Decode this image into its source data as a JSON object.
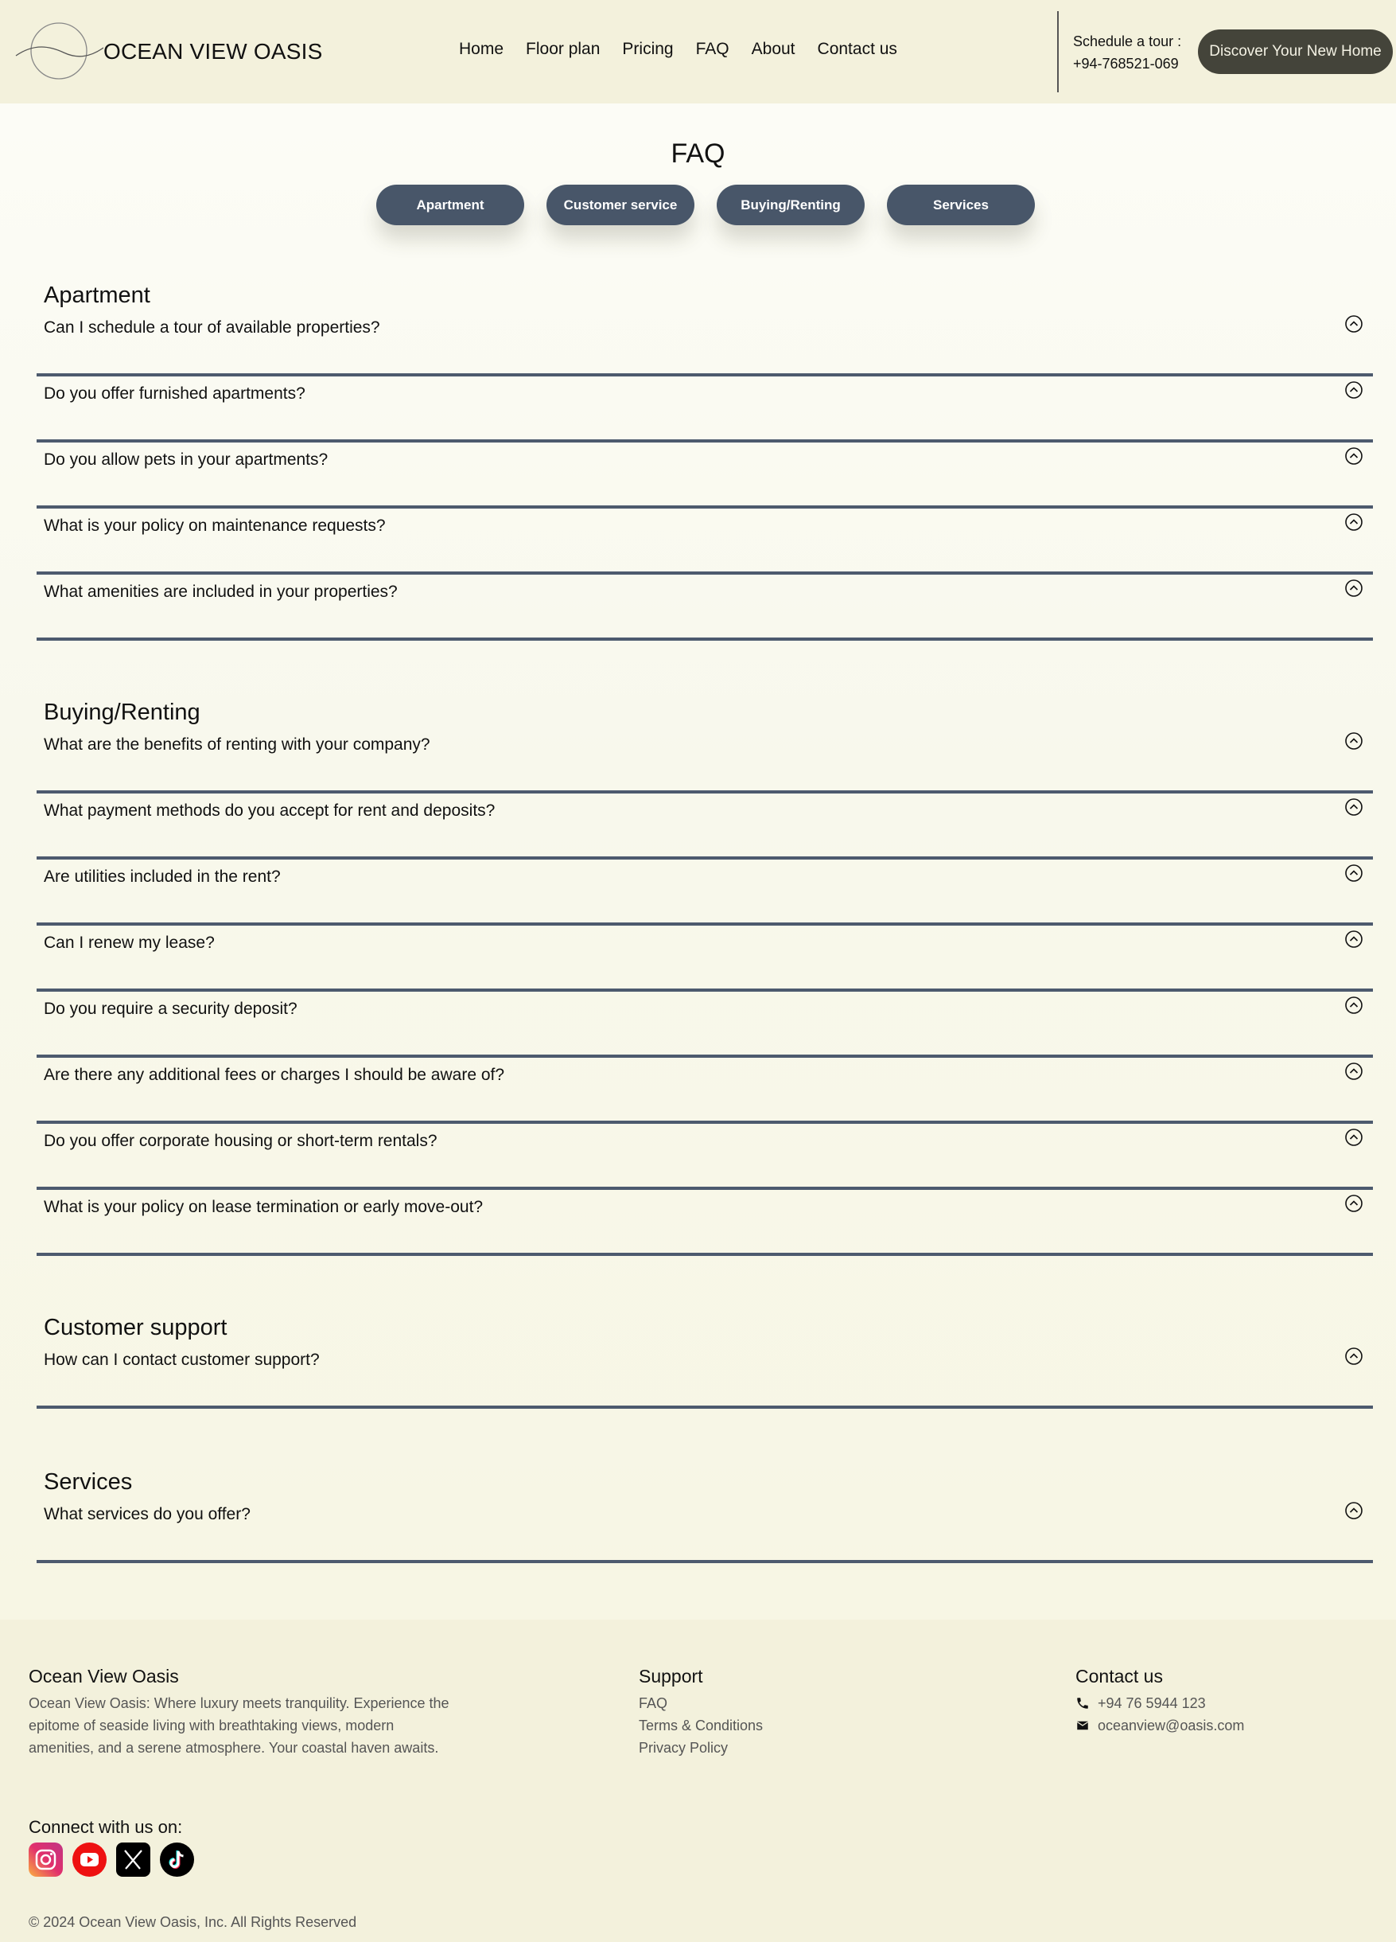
{
  "header": {
    "logo_text": "OCEAN VIEW OASIS",
    "nav": [
      "Home",
      "Floor plan",
      "Pricing",
      "FAQ",
      "About",
      "Contact us"
    ],
    "schedule_label": "Schedule a tour :",
    "schedule_phone": "+94-768521-069",
    "cta_label": "Discover Your New Home"
  },
  "page": {
    "title": "FAQ",
    "filters": [
      "Apartment",
      "Customer service",
      "Buying/Renting",
      "Services"
    ]
  },
  "sections": [
    {
      "title": "Apartment",
      "questions": [
        "Can I schedule a tour of available properties?",
        "Do you offer furnished apartments?",
        "Do you allow pets in your apartments?",
        "What is your policy on maintenance requests?",
        "What amenities are included in your properties?"
      ]
    },
    {
      "title": "Buying/Renting",
      "questions": [
        "What are the benefits of renting with your company?",
        "What payment methods do you accept for rent and deposits?",
        "Are utilities included in the rent?",
        "Can I renew my lease?",
        "Do you require a security deposit?",
        "Are there any additional fees or charges I should be aware of?",
        "Do you offer corporate housing or short-term rentals?",
        "What is your policy on lease termination or early move-out?"
      ]
    },
    {
      "title": "Customer support",
      "questions": [
        "How can I contact customer support?"
      ]
    },
    {
      "title": "Services",
      "questions": [
        "What services do you offer?"
      ]
    }
  ],
  "footer": {
    "brand_title": "Ocean View Oasis",
    "brand_desc": "Ocean View Oasis: Where luxury meets tranquility. Experience the epitome of seaside living with breathtaking views, modern amenities, and a serene atmosphere. Your coastal haven awaits.",
    "support_title": "Support",
    "support_links": [
      "FAQ",
      "Terms & Conditions",
      "Privacy Policy"
    ],
    "contact_title": "Contact us",
    "phone": "+94 76 5944 123",
    "email": "oceanview@oasis.com",
    "connect_label": "Connect with us on:",
    "social_icons": [
      "instagram-icon",
      "youtube-icon",
      "x-icon",
      "tiktok-icon"
    ],
    "copyright": "© 2024 Ocean View Oasis, Inc. All Rights Reserved"
  },
  "colors": {
    "header_bg": "#f3f1dc",
    "pill_bg": "#485669",
    "cta_bg": "#44443a",
    "divider": "#4d5a6e"
  }
}
